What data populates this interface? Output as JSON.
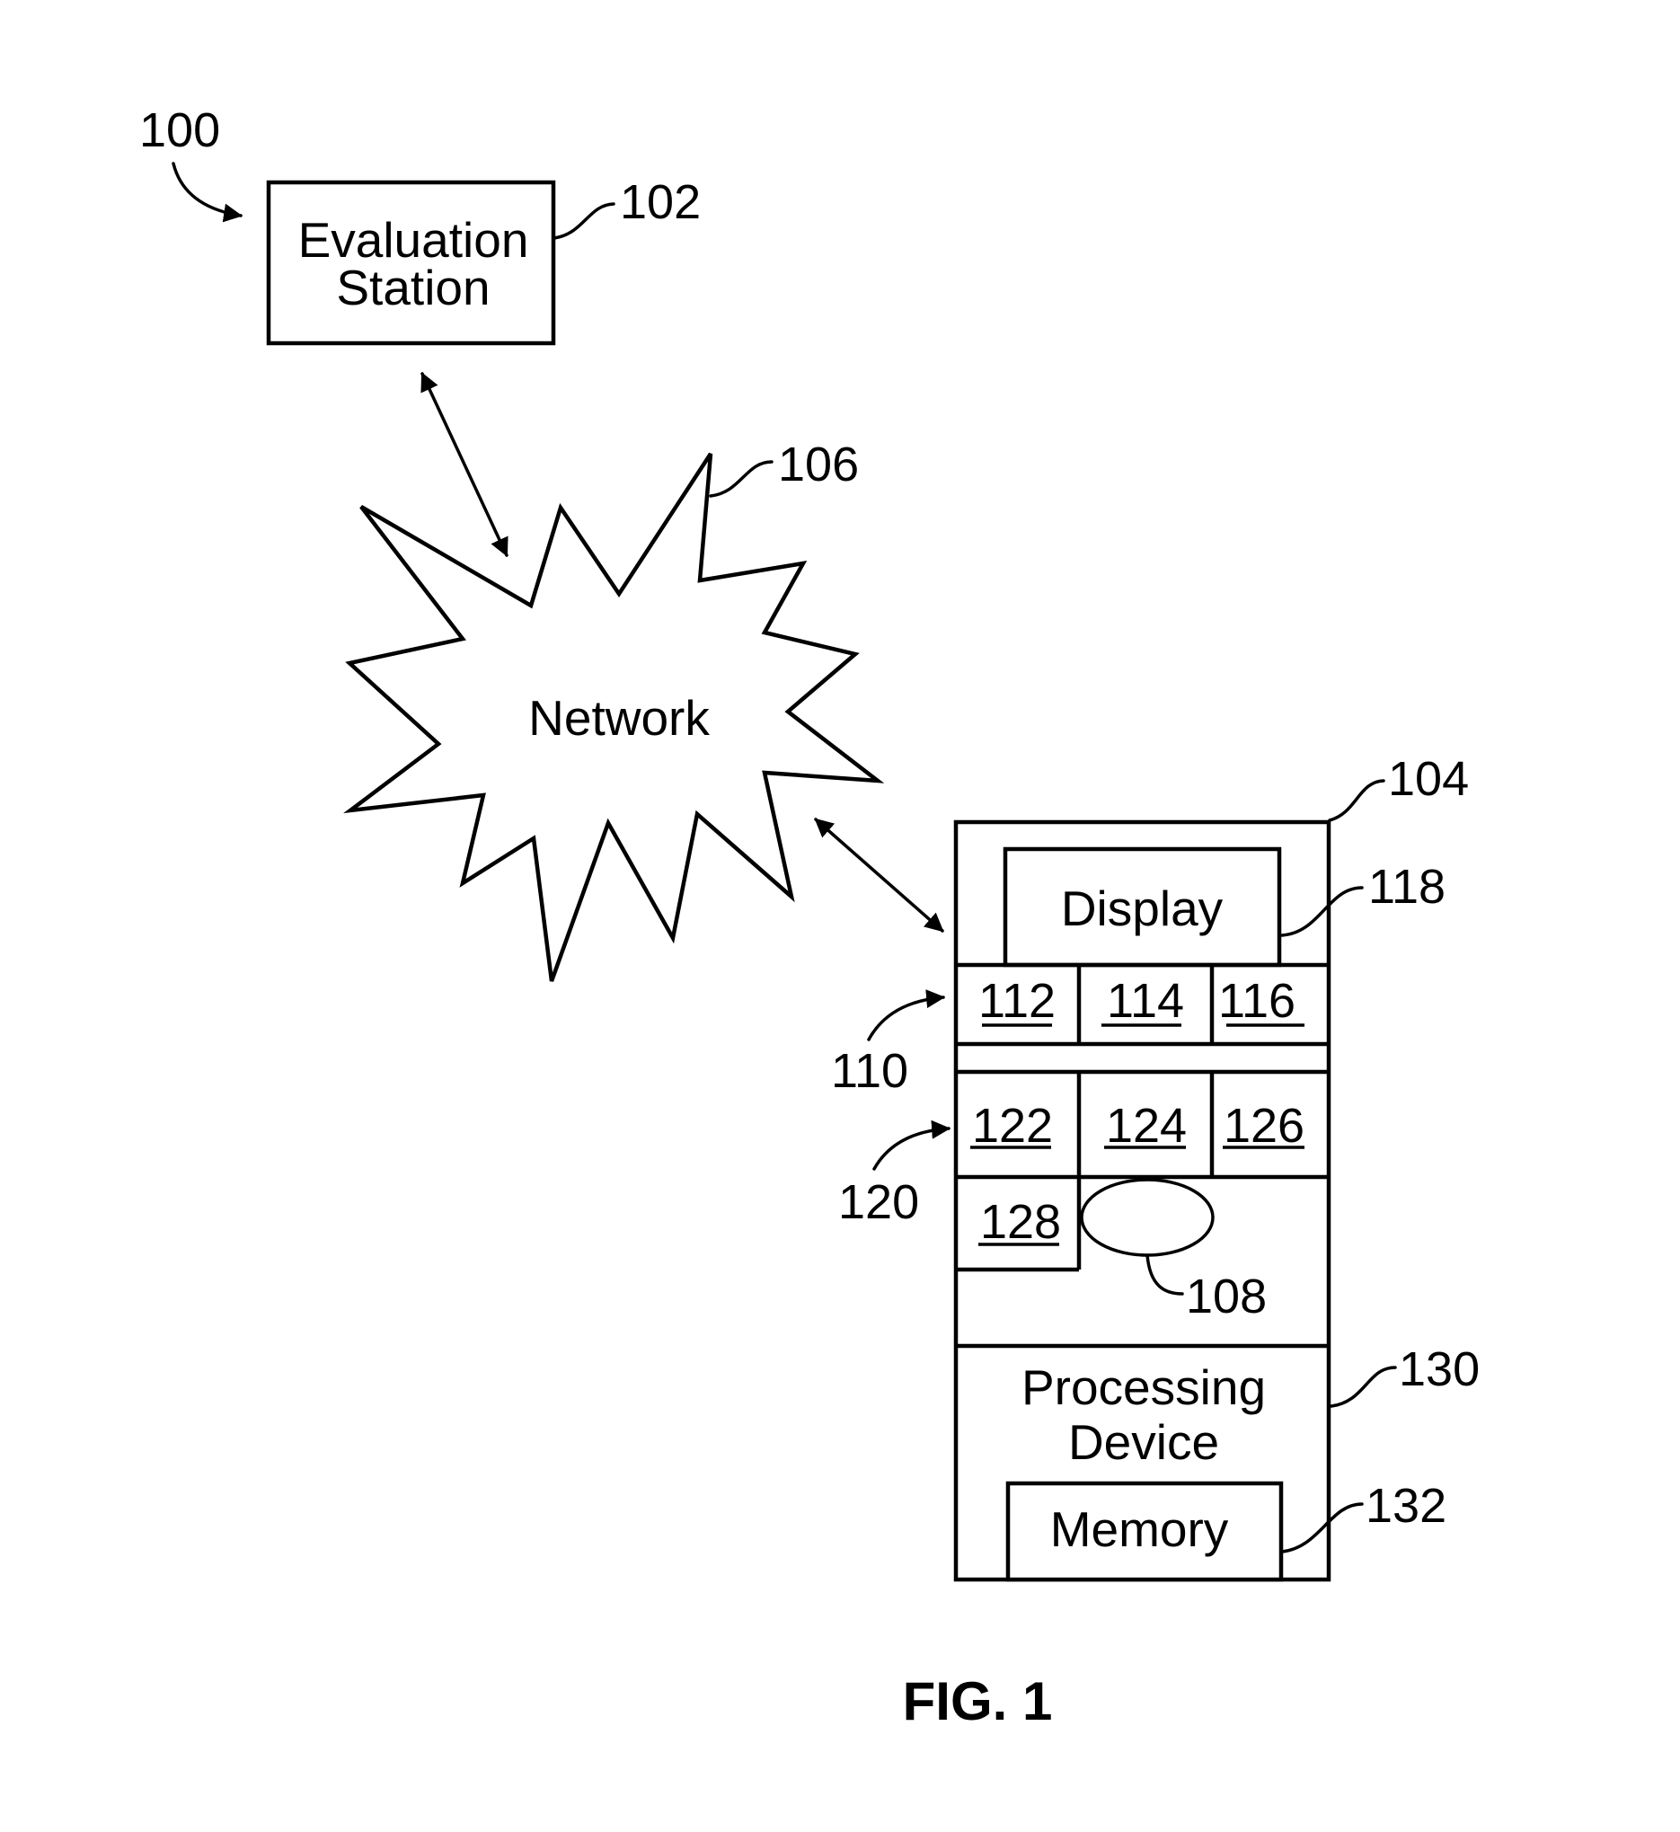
{
  "figure": {
    "caption": "FIG. 1",
    "system_ref": "100"
  },
  "evaluation_station": {
    "ref": "102",
    "line1": "Evaluation",
    "line2": "Station"
  },
  "network": {
    "ref": "106",
    "label": "Network"
  },
  "device": {
    "ref": "104",
    "display": {
      "ref": "118",
      "label": "Display"
    },
    "row1": {
      "ref": "110",
      "cells": [
        "112",
        "114",
        "116"
      ]
    },
    "row2": {
      "ref": "120",
      "cells": [
        "122",
        "124",
        "126"
      ]
    },
    "cell_128": "128",
    "element_108": {
      "ref": "108"
    },
    "processing": {
      "ref": "130",
      "line1": "Processing",
      "line2": "Device"
    },
    "memory": {
      "ref": "132",
      "label": "Memory"
    }
  }
}
